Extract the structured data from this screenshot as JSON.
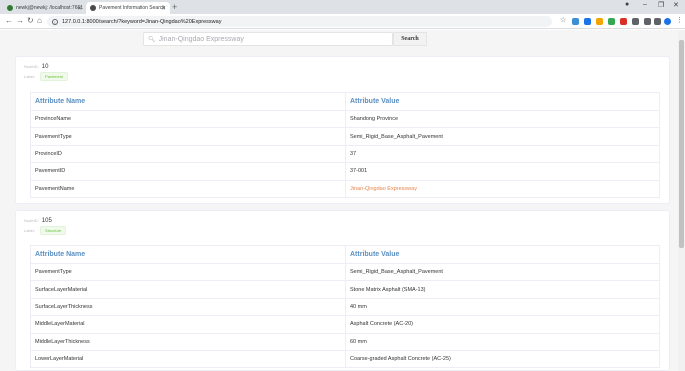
{
  "browser": {
    "tabs": [
      {
        "label": "newkj@newkj: /localhost:7661",
        "color": "#2e7d32"
      },
      {
        "label": "Pavement Information Search",
        "color": "#4a4a4a"
      }
    ],
    "url": "127.0.0.1:8000/search/?keyword=Jinan-Qingdao%20Expressway"
  },
  "search": {
    "query": "Jinan-Qingdao Expressway",
    "button_label": "Search"
  },
  "cards": [
    {
      "node_label": "NodeID",
      "node_id": "10",
      "label_label": "Label",
      "label_value": "Pavement",
      "header_name": "Attribute Name",
      "header_value": "Attribute Value",
      "rows": [
        {
          "name": "ProvinceName",
          "value": "Shandong Province"
        },
        {
          "name": "PavementType",
          "value": "Semi_Rigid_Base_Asphalt_Pavement"
        },
        {
          "name": "ProvinceID",
          "value": "37"
        },
        {
          "name": "PavementID",
          "value": "37-001"
        },
        {
          "name": "PavementName",
          "value": "Jinan-Qingdao Expressway"
        }
      ]
    },
    {
      "node_label": "NodeID",
      "node_id": "105",
      "label_label": "Label",
      "label_value": "Structure",
      "header_name": "Attribute Name",
      "header_value": "Attribute Value",
      "rows": [
        {
          "name": "PavementType",
          "value": "Semi_Rigid_Base_Asphalt_Pavement"
        },
        {
          "name": "SurfaceLayerMaterial",
          "value": "Stone Matrix Asphalt (SMA-13)"
        },
        {
          "name": "SurfaceLayerThickness",
          "value": "40 mm"
        },
        {
          "name": "MiddleLayerMaterial",
          "value": "Asphalt Concrete (AC-20)"
        },
        {
          "name": "MiddleLayerThickness",
          "value": "60 mm"
        },
        {
          "name": "LowerLayerMaterial",
          "value": "Coarse-graded Asphalt Concrete (AC-25)"
        }
      ]
    }
  ]
}
